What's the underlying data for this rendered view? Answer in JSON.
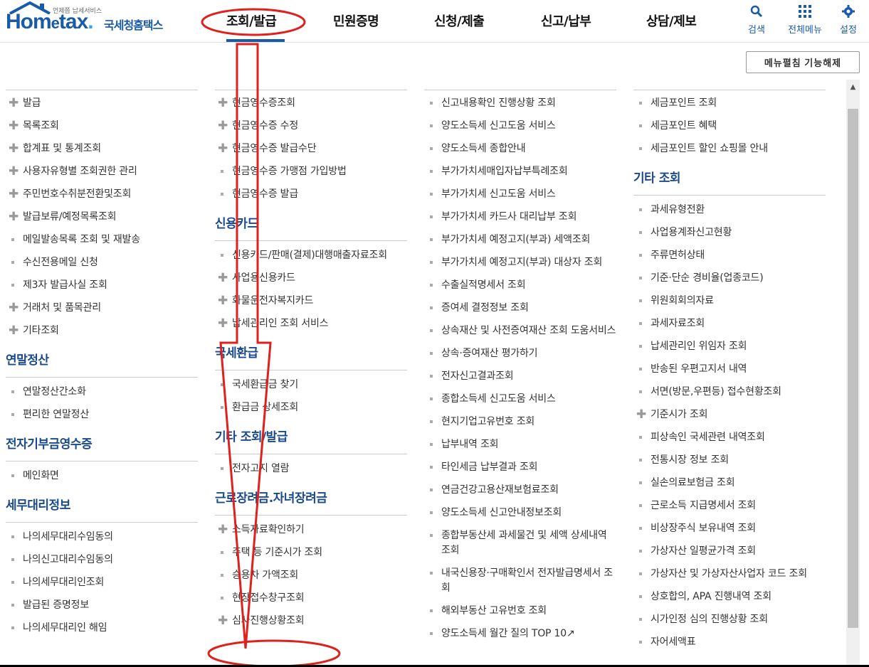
{
  "header": {
    "logo_sub": "언제쯤 납세서비스",
    "logo_brand_a": "Hom",
    "logo_brand_e": "e",
    "logo_brand_b": "tax",
    "logo_brand_dot": ".",
    "logo_kr": "국세청홈택스",
    "nav": [
      "조회/발급",
      "민원증명",
      "신청/제출",
      "신고/납부",
      "상담/제보"
    ],
    "tools": [
      {
        "label": "검색",
        "icon": "search-icon"
      },
      {
        "label": "전체메뉴",
        "icon": "grid-menu-icon"
      },
      {
        "label": "설정",
        "icon": "gear-icon"
      }
    ],
    "colors": {
      "brand": "#1a5ba8",
      "section_title": "#1a4a8c",
      "annotation": "#e0201c"
    }
  },
  "unfold_button": "메뉴펼침 기능해제",
  "col1": {
    "items": [
      {
        "b": "plus",
        "t": "발급"
      },
      {
        "b": "plus",
        "t": "목록조회"
      },
      {
        "b": "plus",
        "t": "합계표 및 통계조회"
      },
      {
        "b": "plus",
        "t": "사용자유형별 조회권한 관리"
      },
      {
        "b": "plus",
        "t": "주민번호수취분전환및조회"
      },
      {
        "b": "plus",
        "t": "발급보류/예정목록조회"
      },
      {
        "b": "sq",
        "t": "메일발송목록 조회 및 재발송"
      },
      {
        "b": "sq",
        "t": "수신전용메일 신청"
      },
      {
        "b": "sq",
        "t": "제3자 발급사실 조회"
      },
      {
        "b": "plus",
        "t": "거래처 및 품목관리"
      },
      {
        "b": "plus",
        "t": "기타조회"
      }
    ],
    "sections": [
      {
        "title": "연말정산",
        "items": [
          {
            "b": "sq",
            "t": "연말정산간소화"
          },
          {
            "b": "sq",
            "t": "편리한 연말정산"
          }
        ]
      },
      {
        "title": "전자기부금영수증",
        "items": [
          {
            "b": "sq",
            "t": "메인화면"
          }
        ]
      },
      {
        "title": "세무대리정보",
        "items": [
          {
            "b": "sq",
            "t": "나의세무대리수임동의"
          },
          {
            "b": "sq",
            "t": "나의신고대리수임동의"
          },
          {
            "b": "sq",
            "t": "나의세무대리인조회"
          },
          {
            "b": "sq",
            "t": "발급된 증명정보"
          },
          {
            "b": "sq",
            "t": "나의세무대리인 해임"
          }
        ]
      }
    ]
  },
  "col2": {
    "items": [
      {
        "b": "plus",
        "t": "현금영수증조회"
      },
      {
        "b": "plus",
        "t": "현금영수증 수정"
      },
      {
        "b": "plus",
        "t": "현금영수증 발급수단"
      },
      {
        "b": "sq",
        "t": "현금영수증 가맹점 가입방법"
      },
      {
        "b": "sq",
        "t": "현금영수증 발급"
      }
    ],
    "sections": [
      {
        "title": "신용카드",
        "items": [
          {
            "b": "sq",
            "t": "신용카드/판매(결제)대행매출자료조회"
          },
          {
            "b": "plus",
            "t": "사업용신용카드"
          },
          {
            "b": "plus",
            "t": "화물운전자복지카드"
          },
          {
            "b": "plus",
            "t": "납세관리인 조회 서비스"
          }
        ]
      },
      {
        "title": "국세환급",
        "items": [
          {
            "b": "sq",
            "t": "국세환급금 찾기"
          },
          {
            "b": "sq",
            "t": "환급금 상세조회"
          }
        ]
      },
      {
        "title": "기타 조회/발급",
        "items": [
          {
            "b": "sq",
            "t": "전자고지 열람"
          }
        ]
      },
      {
        "title": "근로장려금.자녀장려금",
        "items": [
          {
            "b": "plus",
            "t": "소득자료확인하기"
          },
          {
            "b": "sq",
            "t": "주택 등 기준시가 조회"
          },
          {
            "b": "sq",
            "t": "승용차 가액조회"
          },
          {
            "b": "sq",
            "t": "현장접수창구조회"
          },
          {
            "b": "plus",
            "t": "심사진행상황조회"
          }
        ]
      }
    ]
  },
  "col3": {
    "items": [
      {
        "b": "sq",
        "t": "신고내용확인 진행상황 조회"
      },
      {
        "b": "sq",
        "t": "양도소득세 신고도움 서비스"
      },
      {
        "b": "sq",
        "t": "양도소득세 종합안내"
      },
      {
        "b": "sq",
        "t": "부가가치세매입자납부특례조회"
      },
      {
        "b": "sq",
        "t": "부가가치세 신고도움 서비스"
      },
      {
        "b": "sq",
        "t": "부가가치세 카드사 대리납부 조회"
      },
      {
        "b": "sq",
        "t": "부가가치세 예정고지(부과) 세액조회"
      },
      {
        "b": "sq",
        "t": "부가가치세 예정고지(부과) 대상자 조회"
      },
      {
        "b": "sq",
        "t": "수출실적명세서 조회"
      },
      {
        "b": "sq",
        "t": "증여세 결정정보 조회"
      },
      {
        "b": "sq",
        "t": "상속재산 및 사전증여재산 조회 도움서비스"
      },
      {
        "b": "sq",
        "t": "상속·증여재산 평가하기"
      },
      {
        "b": "sq",
        "t": "전자신고결과조회"
      },
      {
        "b": "sq",
        "t": "종합소득세 신고도움 서비스"
      },
      {
        "b": "sq",
        "t": "현지기업고유번호 조회"
      },
      {
        "b": "sq",
        "t": "납부내역 조회"
      },
      {
        "b": "sq",
        "t": "타인세금 납부결과 조회"
      },
      {
        "b": "sq",
        "t": "연금건강고용산재보험료조회"
      },
      {
        "b": "sq",
        "t": "양도소득세 신고안내정보조회"
      },
      {
        "b": "sq",
        "t": "종합부동산세 과세물건 및 세액 상세내역 조회"
      },
      {
        "b": "sq",
        "t": "내국신용장·구매확인서 전자발급명세서 조회"
      },
      {
        "b": "sq",
        "t": "해외부동산 고유번호 조회"
      },
      {
        "b": "sq",
        "t": "양도소득세 월간 질의 TOP 10↗"
      }
    ]
  },
  "col4": {
    "items": [
      {
        "b": "sq",
        "t": "세금포인트 조회"
      },
      {
        "b": "sq",
        "t": "세금포인트 혜택"
      },
      {
        "b": "sq",
        "t": "세금포인트 할인 쇼핑몰 안내"
      }
    ],
    "sections": [
      {
        "title": "기타 조회",
        "items": [
          {
            "b": "sq",
            "t": "과세유형전환"
          },
          {
            "b": "sq",
            "t": "사업용계좌신고현황"
          },
          {
            "b": "sq",
            "t": "주류면허상태"
          },
          {
            "b": "sq",
            "t": "기준·단순 경비율(업종코드)"
          },
          {
            "b": "sq",
            "t": "위원회회의자료"
          },
          {
            "b": "sq",
            "t": "과세자료조회"
          },
          {
            "b": "sq",
            "t": "납세관리인 위임자 조회"
          },
          {
            "b": "sq",
            "t": "반송된 우편고지서 내역"
          },
          {
            "b": "sq",
            "t": "서면(방문,우편등) 접수현황조회"
          },
          {
            "b": "plus",
            "t": "기준시가 조회"
          },
          {
            "b": "sq",
            "t": "피상속인 국세관련 내역조회"
          },
          {
            "b": "sq",
            "t": "전통시장 정보 조회"
          },
          {
            "b": "sq",
            "t": "실손의료보험금 조회"
          },
          {
            "b": "sq",
            "t": "근로소득 지급명세서 조회"
          },
          {
            "b": "sq",
            "t": "비상장주식 보유내역 조회"
          },
          {
            "b": "sq",
            "t": "가상자산 일평균가격 조회"
          },
          {
            "b": "sq",
            "t": "가상자산 및 가상자산사업자 코드 조회"
          },
          {
            "b": "sq",
            "t": "상호합의, APA 진행내역 조회"
          },
          {
            "b": "sq",
            "t": "시가인정 심의 진행상황 조회"
          },
          {
            "b": "sq",
            "t": "자어세액표"
          }
        ]
      }
    ]
  }
}
